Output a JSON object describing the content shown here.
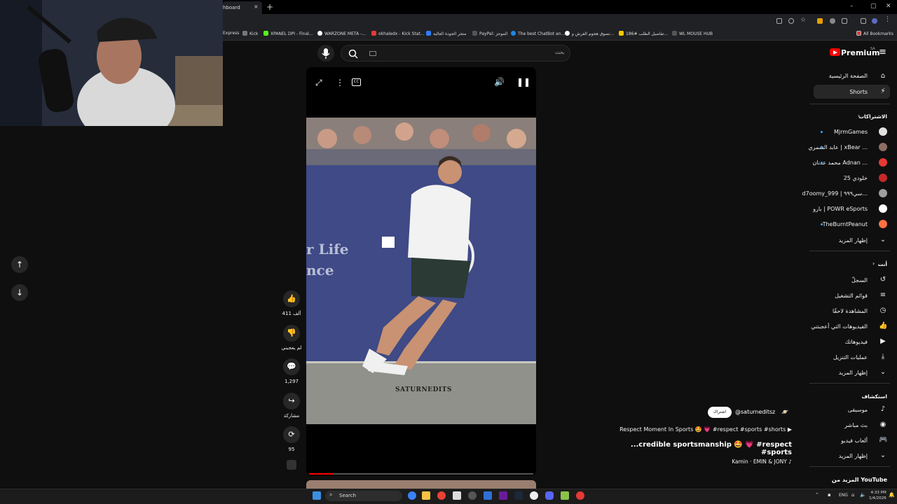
{
  "browser": {
    "tab_title": "hboard",
    "tab_close": "×",
    "new_tab": "+",
    "bookmarks": [
      {
        "label": "Express",
        "color": "#777777"
      },
      {
        "label": "Kick",
        "color": "#53fc18"
      },
      {
        "label": "XPANEL DPI - Final...",
        "color": "#ffffff"
      },
      {
        "label": "WARZONE META -...",
        "color": "#e53935"
      },
      {
        "label": "okhaledx - Kick Stat...",
        "color": "#2e7dff"
      },
      {
        "label": "متجر الجودة العالية",
        "color": "#555555"
      },
      {
        "label": "PayPal: الموجز",
        "color": "#1e88e5"
      },
      {
        "label": "The best ChatBot an...",
        "color": "#ffffff"
      },
      {
        "label": "تسوق هجوم الفرش و...",
        "color": "#f9c600"
      },
      {
        "label": "تفاصيل الطلب #186...",
        "color": "#555555"
      },
      {
        "label": "WL MOUSE HUB",
        "color": "#e53935"
      }
    ],
    "all_bookmarks": "All Bookmarks"
  },
  "youtube": {
    "logo": "Premium",
    "logo_region": "SA",
    "search_placeholder": "بحث"
  },
  "sidebar": {
    "home": "الصفحة الرئيسية",
    "shorts": "Shorts",
    "subscriptions_header": "الاشتراكات",
    "subscriptions": [
      {
        "name": "MjrmGames",
        "color": "#e0e0e0",
        "dot": true
      },
      {
        "name": "عابد الشمري | xBear ...",
        "color": "#8d6e63",
        "dot": true
      },
      {
        "name": "محمد عدنان Adnan ...",
        "color": "#e53935",
        "dot": true
      },
      {
        "name": "خلودي 25",
        "color": "#c62828",
        "dot": false
      },
      {
        "name": "d7oomy_999 | سي٩٩٩...",
        "color": "#9e9e9e",
        "dot": false
      },
      {
        "name": "بارو | POWR eSports",
        "color": "#ffffff",
        "dot": false
      },
      {
        "name": "TheBurntPeanut",
        "color": "#ff7043",
        "dot": true
      }
    ],
    "show_more_1": "إظهار المزيد",
    "you_header": "أنت",
    "you_items": [
      {
        "label": "السجلّ",
        "icon": "history-icon",
        "glyph": "↺"
      },
      {
        "label": "قوائم التشغيل",
        "icon": "playlist-icon",
        "glyph": "≡"
      },
      {
        "label": "المشاهدة لاحقًا",
        "icon": "clock-icon",
        "glyph": "◷"
      },
      {
        "label": "الفيديوهات التي أعجبتني",
        "icon": "like-icon",
        "glyph": "👍"
      },
      {
        "label": "فيديوهاتك",
        "icon": "your-videos-icon",
        "glyph": "▶"
      },
      {
        "label": "عمليات التنزيل",
        "icon": "download-icon",
        "glyph": "⤓"
      }
    ],
    "show_more_2": "إظهار المزيد",
    "explore_header": "استكشاف",
    "explore_items": [
      {
        "label": "موسيقى",
        "icon": "music-icon",
        "glyph": "♪"
      },
      {
        "label": "بث مباشر",
        "icon": "live-icon",
        "glyph": "◉"
      },
      {
        "label": "ألعاب فيديو",
        "icon": "gaming-icon",
        "glyph": "🎮"
      }
    ],
    "show_more_3": "إظهار المزيد",
    "more_from": "المزيد من YouTube"
  },
  "actions": {
    "likes": "411 ألف",
    "dislike": "لم يعجبني",
    "comments": "1,297",
    "share": "مشاركة",
    "remix": "95"
  },
  "short": {
    "watermark": "SATURNEDITS",
    "channel": "@saturneditsz",
    "subscribe": "اشتراك",
    "title_small": "Respect Moment In Sports 🤩 💗 #respect #sports #shorts ▶",
    "title_big": "...credible sportsmanship 🤩 💗 #respect #sports",
    "music": "Kamin · EMIN & JONY ♪",
    "progress": 0.11
  },
  "taskbar": {
    "search": "Search",
    "lang": "ENG",
    "time": "4:33 PM",
    "date": "1/4/2026"
  }
}
